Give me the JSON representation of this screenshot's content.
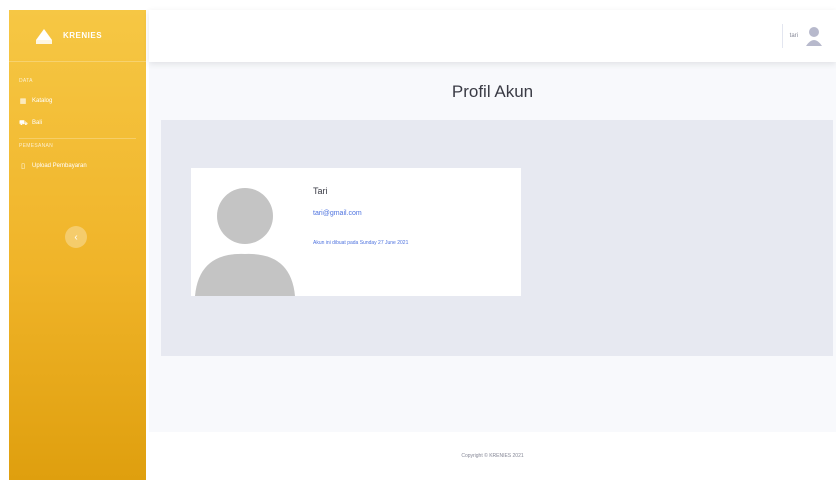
{
  "sidebar": {
    "brand": "KRENIES",
    "headings": [
      "Data",
      "Pemesanan"
    ],
    "items": [
      {
        "label": "Katalog",
        "icon": "grid-icon"
      },
      {
        "label": "Bali",
        "icon": "cart-icon"
      },
      {
        "label": "Upload Pembayaran",
        "icon": "file-icon"
      }
    ],
    "toggle_glyph": "‹"
  },
  "topbar": {
    "user_name": "tari"
  },
  "main": {
    "title": "Profil Akun",
    "profile": {
      "name": "Tari",
      "email": "tari@gmail.com",
      "created": "Akun ini dibuat pada Sunday 27 June 2021"
    }
  },
  "footer": {
    "text": "Copyright © KRENIES 2021"
  },
  "colors": {
    "sidebar_top": "#f6c744",
    "sidebar_bottom": "#df9f0e",
    "accent_link": "#4e73df",
    "panel_bg": "#e7e9f1"
  }
}
